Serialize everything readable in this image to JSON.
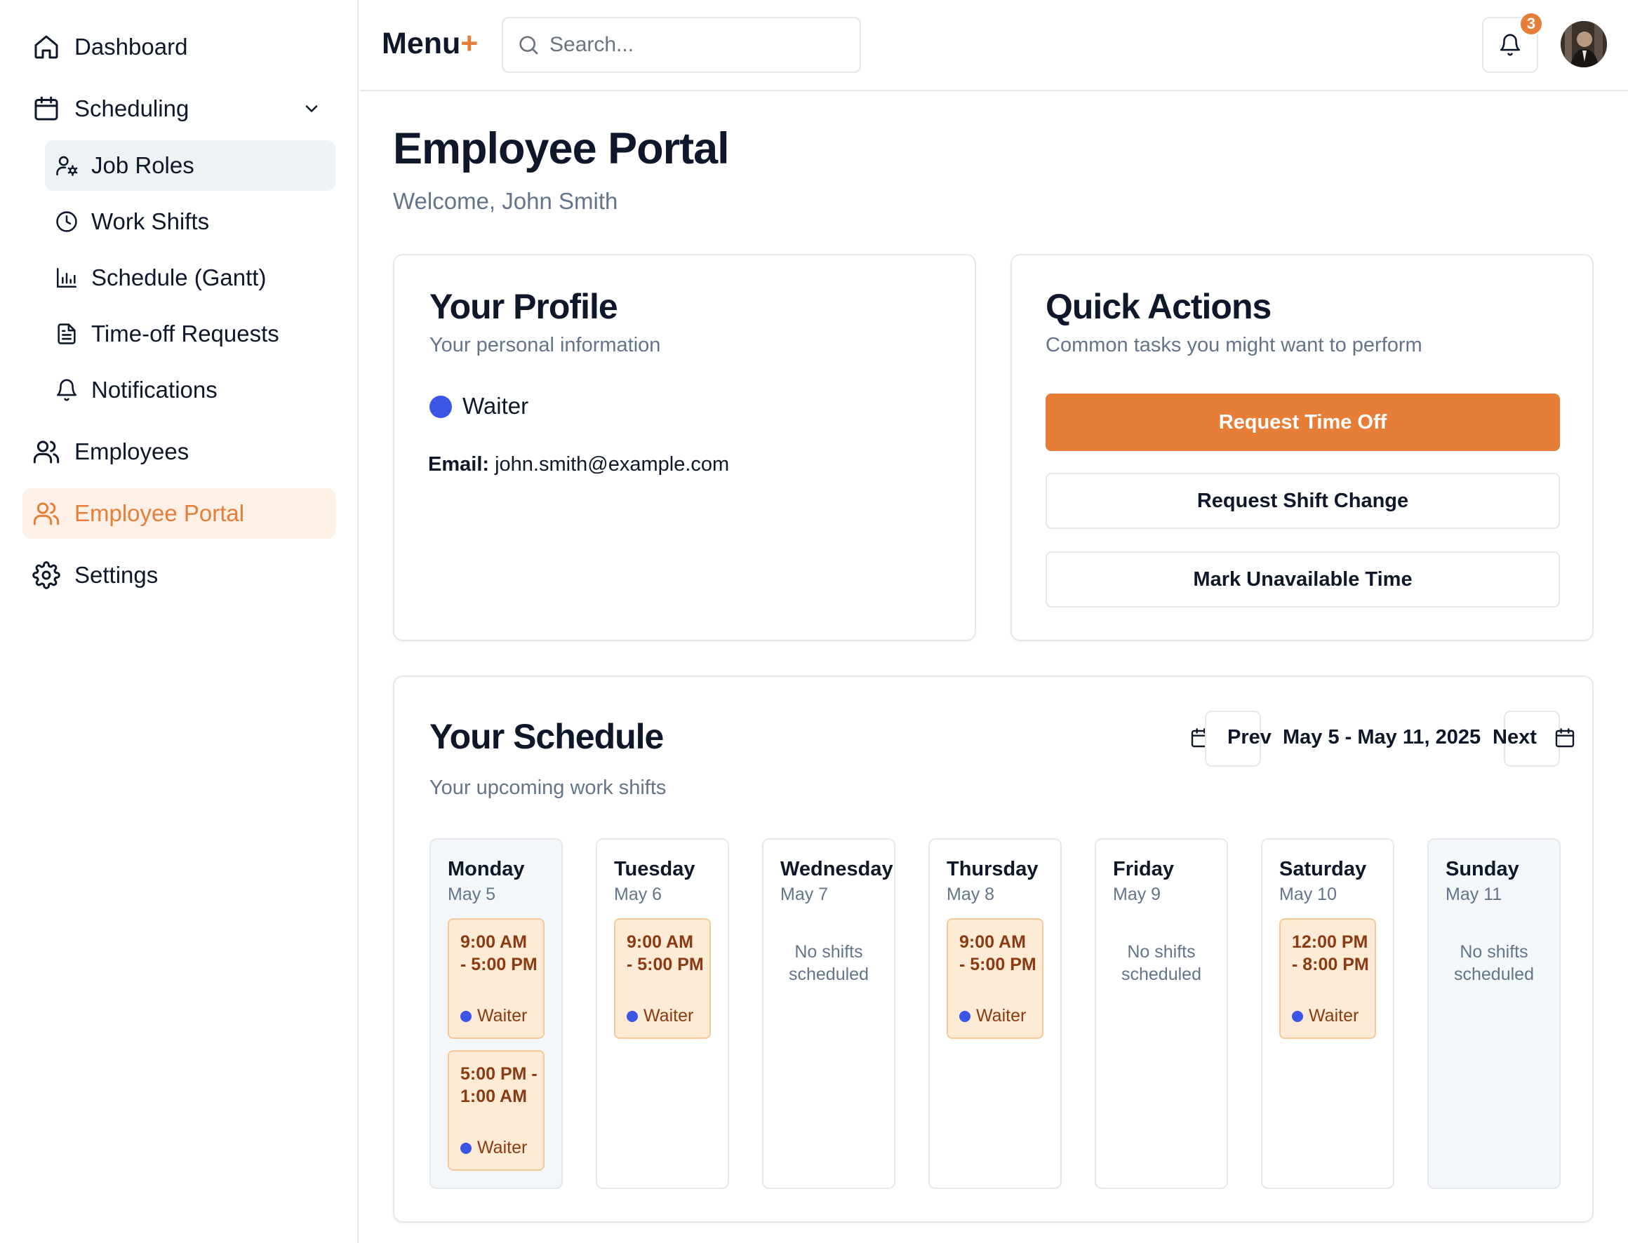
{
  "sidebar": {
    "items": [
      {
        "label": "Dashboard",
        "icon": "home-icon"
      },
      {
        "label": "Scheduling",
        "icon": "calendar-icon"
      },
      {
        "label": "Employees",
        "icon": "users-icon"
      },
      {
        "label": "Employee Portal",
        "icon": "users-icon"
      },
      {
        "label": "Settings",
        "icon": "gear-icon"
      }
    ],
    "scheduling_children": [
      {
        "label": "Job Roles",
        "icon": "user-cog-icon"
      },
      {
        "label": "Work Shifts",
        "icon": "clock-icon"
      },
      {
        "label": "Schedule (Gantt)",
        "icon": "bar-chart-icon"
      },
      {
        "label": "Time-off Requests",
        "icon": "file-text-icon"
      },
      {
        "label": "Notifications",
        "icon": "bell-icon"
      }
    ]
  },
  "header": {
    "brand": "Menu",
    "brand_mark": "+",
    "search_placeholder": "Search...",
    "notification_count": "3"
  },
  "page": {
    "title": "Employee Portal",
    "welcome": "Welcome, John Smith"
  },
  "profile": {
    "title": "Your Profile",
    "subtitle": "Your personal information",
    "role": "Waiter",
    "role_color": "#3b55e6",
    "email_label": "Email:",
    "email": "john.smith@example.com"
  },
  "quick_actions": {
    "title": "Quick Actions",
    "subtitle": "Common tasks you might want to perform",
    "primary": "Request Time Off",
    "secondary": "Request Shift Change",
    "tertiary": "Mark Unavailable Time"
  },
  "schedule": {
    "title": "Your Schedule",
    "subtitle": "Your upcoming work shifts",
    "prev_label": "Prev",
    "next_label": "Next",
    "range": "May 5 - May 11, 2025",
    "empty_text": "No shifts scheduled",
    "days": [
      {
        "name": "Monday",
        "date": "May 5",
        "shifts": [
          {
            "time": "9:00 AM - 5:00 PM",
            "role": "Waiter"
          },
          {
            "time": "5:00 PM - 1:00 AM",
            "role": "Waiter"
          }
        ]
      },
      {
        "name": "Tuesday",
        "date": "May 6",
        "shifts": [
          {
            "time": "9:00 AM - 5:00 PM",
            "role": "Waiter"
          }
        ]
      },
      {
        "name": "Wednesday",
        "date": "May 7",
        "shifts": []
      },
      {
        "name": "Thursday",
        "date": "May 8",
        "shifts": [
          {
            "time": "9:00 AM - 5:00 PM",
            "role": "Waiter"
          }
        ]
      },
      {
        "name": "Friday",
        "date": "May 9",
        "shifts": []
      },
      {
        "name": "Saturday",
        "date": "May 10",
        "shifts": [
          {
            "time": "12:00 PM - 8:00 PM",
            "role": "Waiter"
          }
        ]
      },
      {
        "name": "Sunday",
        "date": "May 11",
        "shifts": []
      }
    ]
  },
  "colors": {
    "accent": "#e67e37",
    "active_bg": "#fdf0e6",
    "shift_bg": "#fdebd6",
    "shift_text": "#8b3a12"
  }
}
